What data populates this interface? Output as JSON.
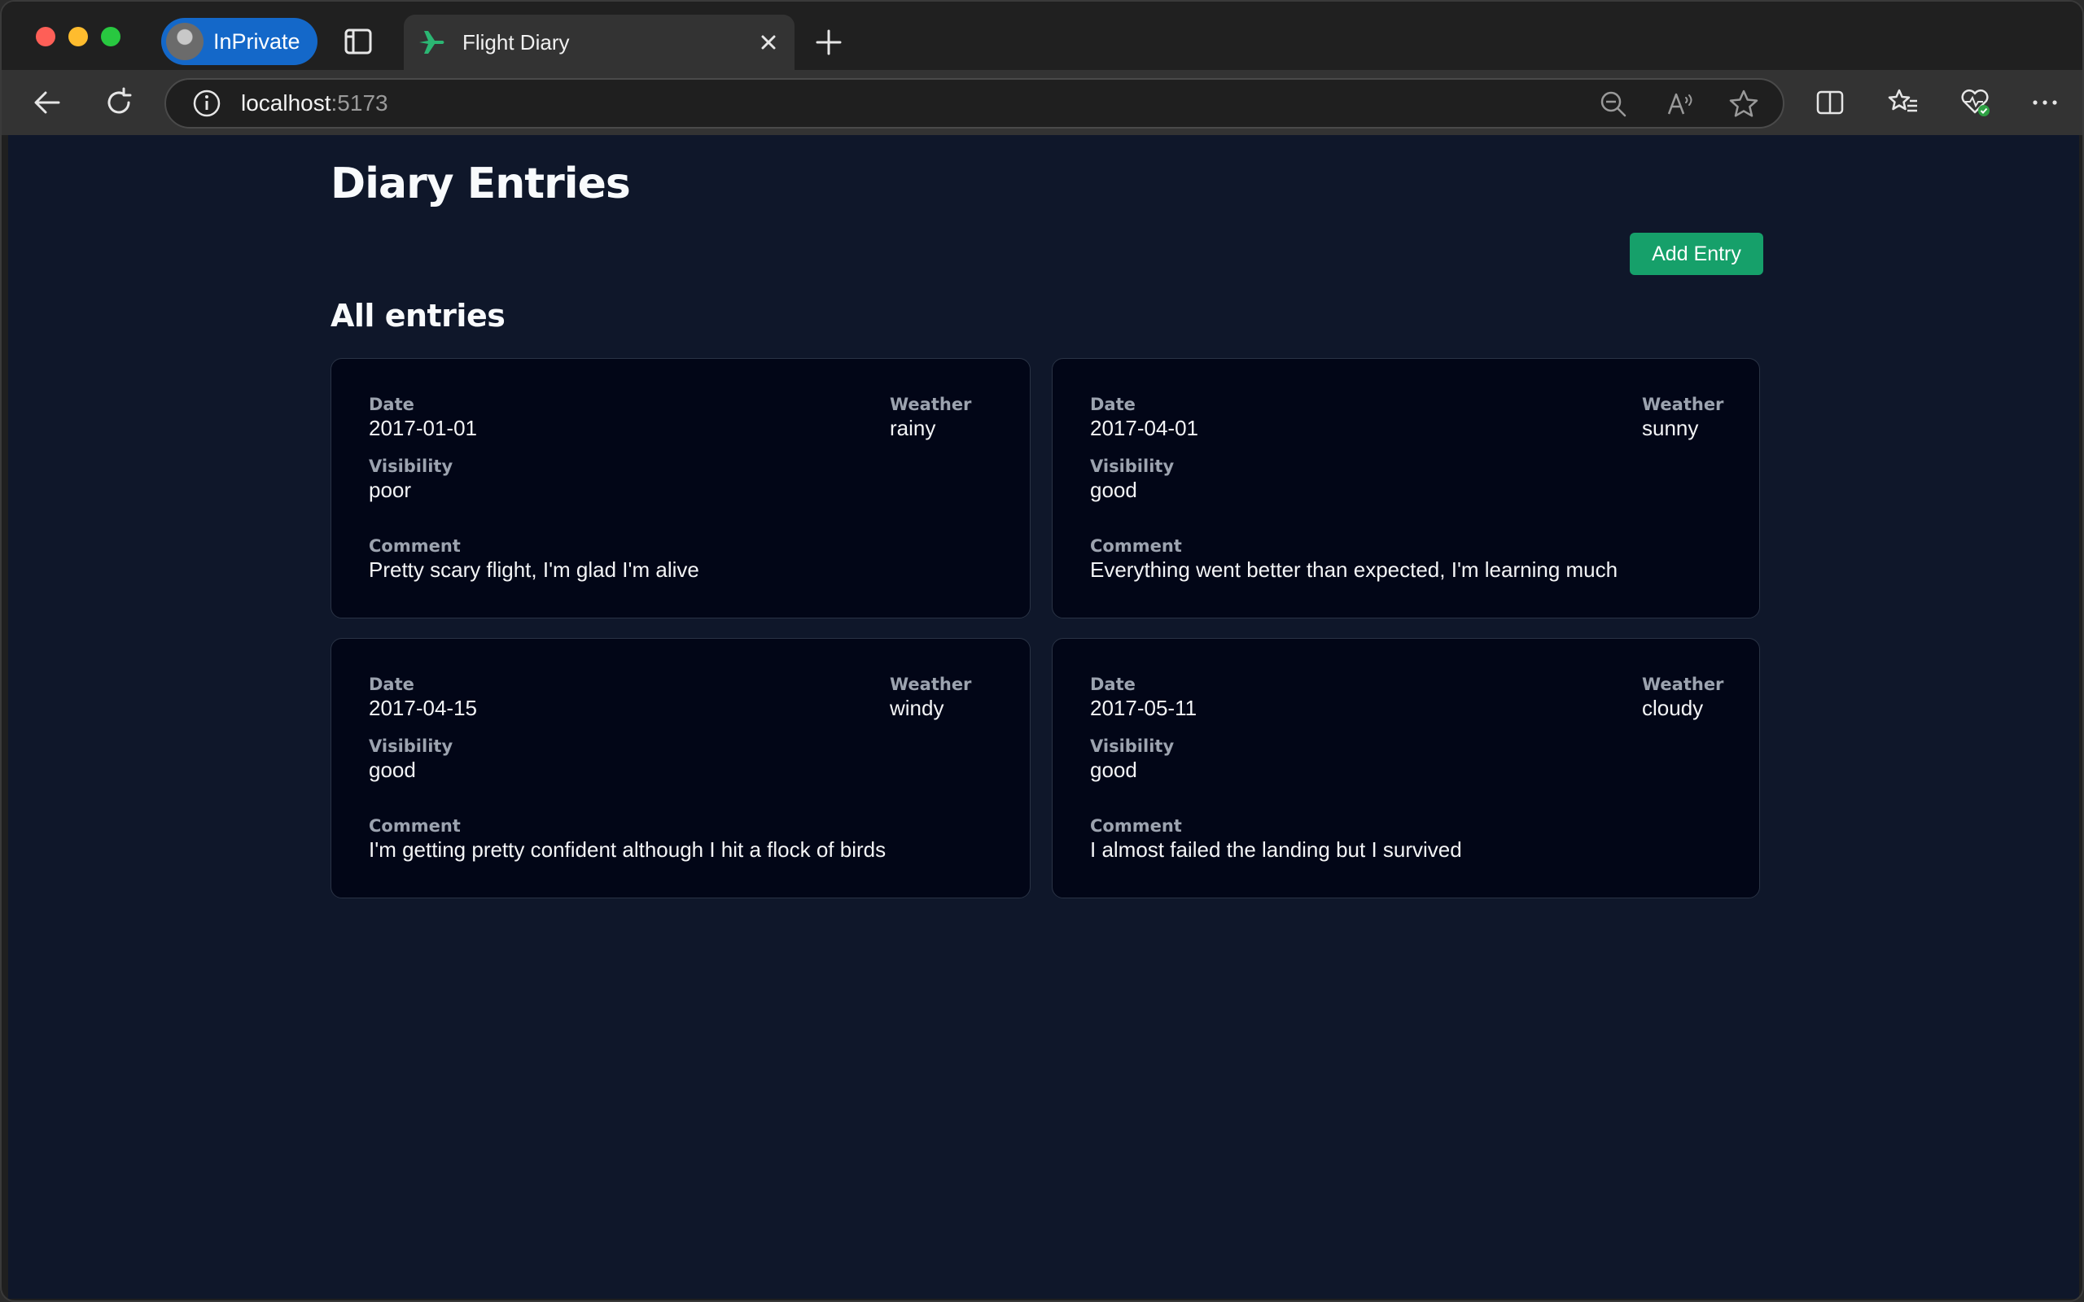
{
  "browser": {
    "profile_label": "InPrivate",
    "tab_title": "Flight Diary",
    "url_host": "localhost",
    "url_port": ":5173"
  },
  "page": {
    "title": "Diary Entries",
    "add_button": "Add Entry",
    "section_title": "All entries"
  },
  "labels": {
    "date": "Date",
    "weather": "Weather",
    "visibility": "Visibility",
    "comment": "Comment"
  },
  "entries": [
    {
      "date": "2017-01-01",
      "weather": "rainy",
      "visibility": "poor",
      "comment": "Pretty scary flight, I'm glad I'm alive"
    },
    {
      "date": "2017-04-01",
      "weather": "sunny",
      "visibility": "good",
      "comment": "Everything went better than expected, I'm learning much"
    },
    {
      "date": "2017-04-15",
      "weather": "windy",
      "visibility": "good",
      "comment": "I'm getting pretty confident although I hit a flock of birds"
    },
    {
      "date": "2017-05-11",
      "weather": "cloudy",
      "visibility": "good",
      "comment": "I almost failed the landing but I survived"
    }
  ],
  "colors": {
    "page_bg": "#0f172a",
    "card_bg": "#020617",
    "accent_green": "#16a06a",
    "profile_blue": "#1468c9"
  },
  "icons": [
    "close-window-icon",
    "minimize-window-icon",
    "maximize-window-icon",
    "tab-actions-icon",
    "airplane-icon",
    "close-icon",
    "plus-icon",
    "back-arrow-icon",
    "refresh-icon",
    "info-icon",
    "zoom-out-icon",
    "read-aloud-icon",
    "star-icon",
    "split-screen-icon",
    "favorites-icon",
    "browser-essentials-icon",
    "more-icon"
  ]
}
